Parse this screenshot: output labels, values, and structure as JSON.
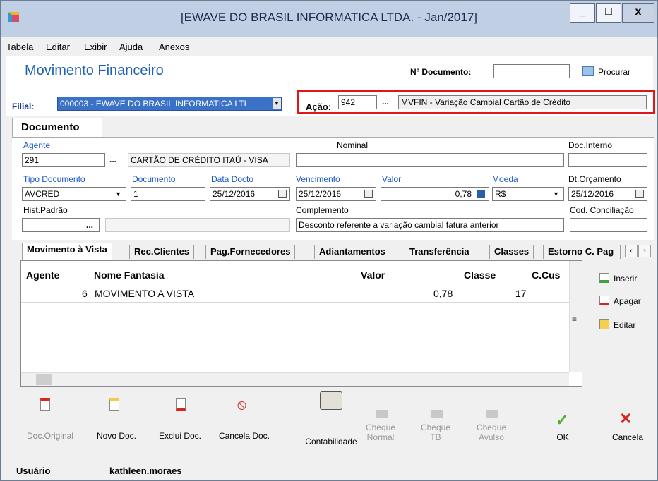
{
  "window": {
    "title": "[EWAVE DO BRASIL INFORMATICA LTDA. - Jan/2017]",
    "min": "_",
    "max": "□",
    "close": "x"
  },
  "menu": [
    "Tabela",
    "Editar",
    "Exibir",
    "Ajuda",
    "Anexos"
  ],
  "header": {
    "title": "Movimento Financeiro",
    "doc_label": "Nº Documento:",
    "doc_value": "",
    "search_label": "Procurar"
  },
  "filial": {
    "label": "Filial:",
    "value": "000003 - EWAVE DO BRASIL INFORMATICA LTI"
  },
  "acao": {
    "label": "Ação:",
    "code": "942",
    "dots": "...",
    "desc": "MVFIN - Variação Cambial Cartão de Crédito"
  },
  "doc_tab": "Documento",
  "fields": {
    "agente_label": "Agente",
    "agente_value": "291",
    "agente_dots": "...",
    "agente_name": "CARTÃO DE CRÉDITO ITAÚ - VISA",
    "nominal_label": "Nominal",
    "nominal_value": "",
    "doc_interno_label": "Doc.Interno",
    "doc_interno_value": "",
    "tipo_doc_label": "Tipo Documento",
    "tipo_doc_value": "AVCRED",
    "documento_label": "Documento",
    "documento_value": "1",
    "data_docto_label": "Data Docto",
    "data_docto_value": "25/12/2016",
    "vencimento_label": "Vencimento",
    "vencimento_value": "25/12/2016",
    "valor_label": "Valor",
    "valor_value": "0,78",
    "moeda_label": "Moeda",
    "moeda_value": "R$",
    "dt_orcamento_label": "Dt.Orçamento",
    "dt_orcamento_value": "25/12/2016",
    "hist_label": "Hist.Padrão",
    "hist_dots": "...",
    "complemento_label": "Complemento",
    "complemento_value": "Desconto referente a variação cambial fatura anterior",
    "cod_conc_label": "Cod. Conciliação",
    "cod_conc_value": ""
  },
  "tabs": [
    "Movimento à Vista",
    "Rec.Clientes",
    "Pag.Fornecedores",
    "Adiantamentos",
    "Transferência",
    "Classes",
    "Estorno C. Pag"
  ],
  "grid": {
    "headers": [
      "Agente",
      "Nome Fantasia",
      "Valor",
      "Classe",
      "C.Cus"
    ],
    "rows": [
      {
        "agente": "6",
        "nome": "MOVIMENTO A VISTA",
        "valor": "0,78",
        "classe": "17",
        "ccus": ""
      }
    ]
  },
  "side_buttons": [
    "Inserir",
    "Apagar",
    "Editar"
  ],
  "toolbar": [
    "Doc.Original",
    "Novo Doc.",
    "Exclui Doc.",
    "Cancela Doc.",
    "Contabilidade",
    "Cheque Normal",
    "Cheque TB",
    "Cheque Avulso",
    "OK",
    "Cancela"
  ],
  "status": {
    "label": "Usuário",
    "value": "kathleen.moraes"
  }
}
